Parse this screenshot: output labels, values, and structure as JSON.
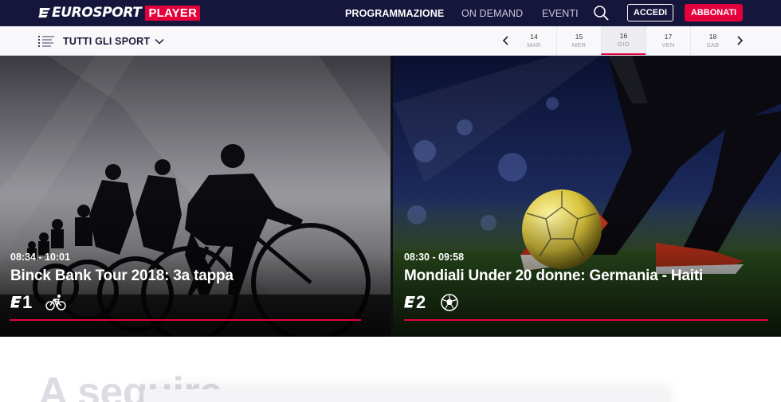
{
  "brand": {
    "name": "EUROSPORT",
    "product": "PLAYER",
    "accent_color": "#e4003a",
    "navbar_color": "#16163d"
  },
  "nav": {
    "items": [
      {
        "label": "PROGRAMMAZIONE",
        "active": true
      },
      {
        "label": "ON DEMAND",
        "active": false
      },
      {
        "label": "EVENTI",
        "active": false
      }
    ],
    "search_icon": "search-icon",
    "login_label": "ACCEDI",
    "subscribe_label": "ABBONATI"
  },
  "filter": {
    "icon": "list-icon",
    "label": "TUTTI GLI SPORT",
    "caret_icon": "chevron-down-icon"
  },
  "days": {
    "prev_icon": "chevron-left-icon",
    "next_icon": "chevron-right-icon",
    "items": [
      {
        "num": "14",
        "weekday": "MAR",
        "selected": false
      },
      {
        "num": "15",
        "weekday": "MER",
        "selected": false
      },
      {
        "num": "16",
        "weekday": "GIO",
        "selected": true
      },
      {
        "num": "17",
        "weekday": "VEN",
        "selected": false
      },
      {
        "num": "18",
        "weekday": "SAB",
        "selected": false
      }
    ]
  },
  "cards": [
    {
      "time": "08:34 - 10:01",
      "title": "Binck Bank Tour 2018: 3a tappa",
      "channel": "1",
      "channel_icon": "eurosport-1-icon",
      "sport_icon": "cycling-icon"
    },
    {
      "time": "08:30 - 09:58",
      "title": "Mondiali Under 20 donne: Germania - Haiti",
      "channel": "2",
      "channel_icon": "eurosport-2-icon",
      "sport_icon": "football-icon"
    }
  ],
  "section": {
    "title": "A seguire"
  }
}
